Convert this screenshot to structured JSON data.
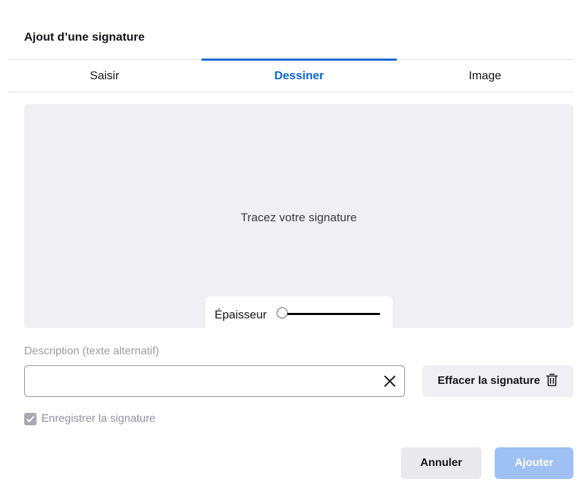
{
  "dialog": {
    "title": "Ajout d’une signature"
  },
  "tabs": [
    {
      "label": "Saisir",
      "active": false
    },
    {
      "label": "Dessiner",
      "active": true
    },
    {
      "label": "Image",
      "active": false
    }
  ],
  "canvas": {
    "placeholder": "Tracez votre signature",
    "thickness_label": "Épaisseur",
    "thickness_value": 0
  },
  "description": {
    "label": "Description (texte alternatif)",
    "value": "",
    "clear_icon": "close-icon"
  },
  "erase_button": {
    "label": "Effacer la signature",
    "icon": "trash-icon"
  },
  "save_signature": {
    "label": "Enregistrer la signature",
    "checked": true
  },
  "buttons": {
    "cancel": "Annuler",
    "add": "Ajouter"
  },
  "colors": {
    "accent": "#0a64d2",
    "add_button_disabled": "#9ec0f3",
    "canvas_bg": "#f0f0f4"
  }
}
